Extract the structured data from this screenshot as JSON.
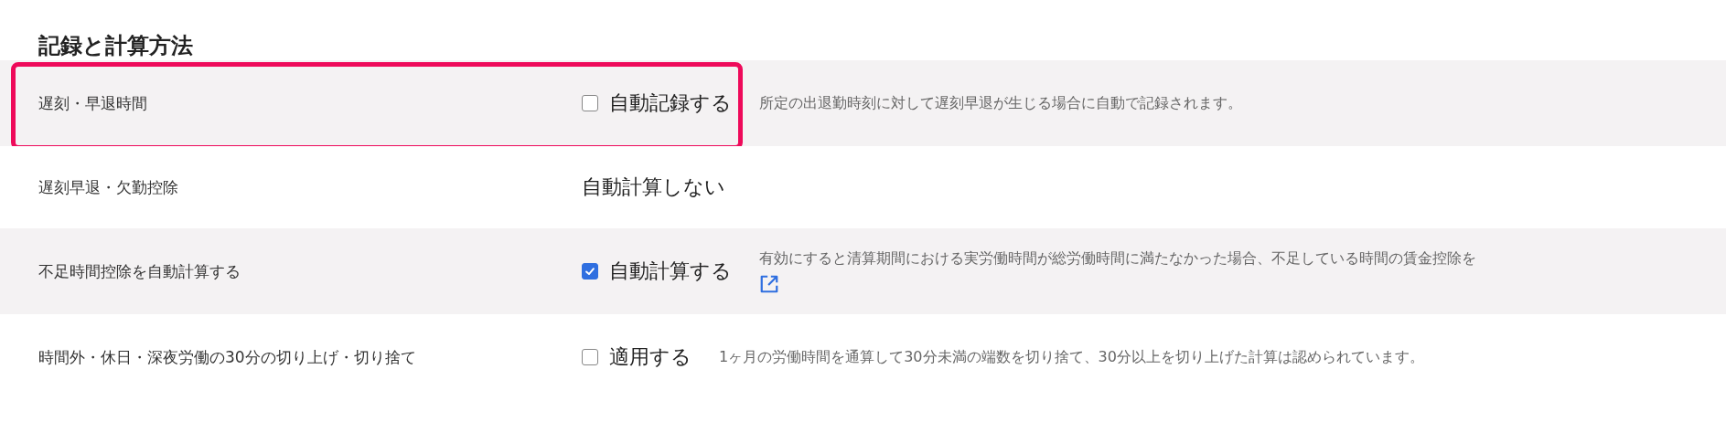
{
  "section": {
    "title": "記録と計算方法"
  },
  "rows": [
    {
      "label": "遅刻・早退時間",
      "kind": "checkbox",
      "checked": false,
      "control": "自動記録する",
      "description": "所定の出退勤時刻に対して遅刻早退が生じる場合に自動で記録されます。",
      "highlighted": true,
      "shaded": true
    },
    {
      "label": "遅刻早退・欠勤控除",
      "kind": "text",
      "control": "自動計算しない",
      "highlighted": false,
      "shaded": false
    },
    {
      "label": "不足時間控除を自動計算する",
      "kind": "checkbox",
      "checked": true,
      "control": "自動計算する",
      "description": "有効にすると清算期間における実労働時間が総労働時間に満たなかった場合、不足している時間の賃金控除を",
      "link": true,
      "highlighted": false,
      "shaded": true
    },
    {
      "label": "時間外・休日・深夜労働の30分の切り上げ・切り捨て",
      "kind": "checkbox",
      "checked": false,
      "control": "適用する",
      "description": "1ヶ月の労働時間を通算して30分未満の端数を切り捨て、30分以上を切り上げた計算は認められています。",
      "highlighted": false,
      "shaded": false
    }
  ]
}
